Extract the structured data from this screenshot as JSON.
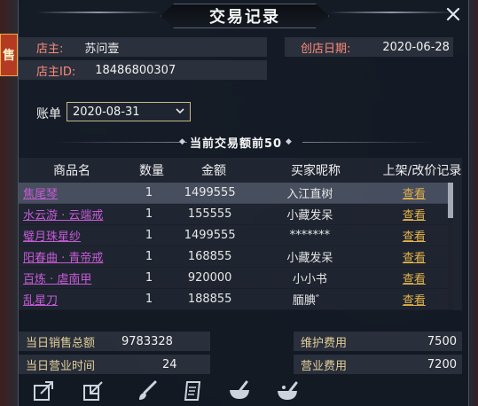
{
  "dialog": {
    "title": "交易记录",
    "close_icon": "close-icon"
  },
  "shop": {
    "owner_label": "店主:",
    "owner_value": "苏问壹",
    "owner_id_label": "店主ID:",
    "owner_id_value": "18486800307",
    "created_label": "创店日期:",
    "created_value": "2020-06-28"
  },
  "account": {
    "label": "账单",
    "selected": "2020-08-31"
  },
  "section": {
    "title": "当前交易额前50"
  },
  "table": {
    "headers": [
      "商品名",
      "数量",
      "金额",
      "买家昵称",
      "上架/改价记录"
    ],
    "rows": [
      {
        "name": "焦尾琴",
        "qty": "1",
        "amount": "1499555",
        "buyer": "入江直树",
        "record": "查看"
      },
      {
        "name": "水云游 · 云端戒",
        "qty": "1",
        "amount": "155555",
        "buyer": "小藏发呆",
        "record": "查看"
      },
      {
        "name": "璧月珠星纱",
        "qty": "1",
        "amount": "1499555",
        "buyer": "*******",
        "record": "查看"
      },
      {
        "name": "阳春曲 · 青帝戒",
        "qty": "1",
        "amount": "168855",
        "buyer": "小藏发呆",
        "record": "查看"
      },
      {
        "name": "百炼 · 虐南甲",
        "qty": "1",
        "amount": "920000",
        "buyer": "小小书",
        "record": "查看"
      },
      {
        "name": "乱星刀",
        "qty": "1",
        "amount": "188855",
        "buyer": "腼腆゛",
        "record": "查看"
      }
    ],
    "selected_row": 0
  },
  "stats": {
    "daily_sales_label": "当日销售总额",
    "daily_sales_value": "9783328",
    "maintenance_label": "维护费用",
    "maintenance_value": "7500",
    "daily_hours_label": "当日营业时间",
    "daily_hours_value": "24",
    "business_fee_label": "营业费用",
    "business_fee_value": "7200"
  },
  "background": {
    "side_tab": "售"
  },
  "toolbar": {
    "icons": [
      "export-icon",
      "import-icon",
      "brush-icon",
      "scroll-icon",
      "mortar-icon",
      "pestle-bowl-icon"
    ]
  },
  "colors": {
    "label_red": "#ff8a7a",
    "item_purple": "#c65bd6",
    "link_gold": "#e2b24a",
    "stat_label": "#e3cf9a"
  }
}
